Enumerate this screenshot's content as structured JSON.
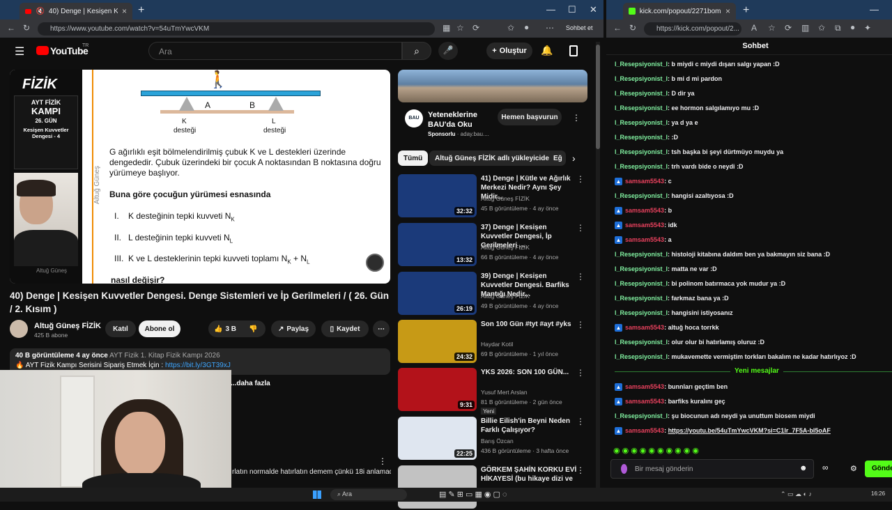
{
  "left_browser": {
    "tab_title": "40) Denge | Kesişen Kuvvetler",
    "url": "https://www.youtube.com/watch?v=54uTmYwcVKM",
    "profile_chip": "Sohbet et"
  },
  "youtube": {
    "logo": "YouTube",
    "logo_sup": "TR",
    "search_placeholder": "Ara",
    "create_label": "Oluştur",
    "video": {
      "brand": "FİZİK",
      "camp": [
        "AYT FİZİK",
        "KAMPI",
        "26. GÜN",
        "Kesişen Kuvvetler",
        "Dengesi - 4"
      ],
      "watermark": "Altuğ Güneş",
      "vert_name": "Altuğ Güneş",
      "label_a": "A",
      "label_b": "B",
      "label_k": "K",
      "label_l": "L",
      "desteği": "desteği",
      "q_text": "G ağırlıklı eşit bölmelendirilmiş çubuk K ve L destekleri üzerinde dengededir. Çubuk üzerindeki bir çocuk A noktasından B noktasına doğru yürümeye başlıyor.",
      "q_head": "Buna göre çocuğun yürümesi esnasında",
      "items": [
        {
          "n": "I.",
          "t": "K desteğinin tepki kuvveti N",
          "s": "K",
          "tail": ""
        },
        {
          "n": "II.",
          "t": "L desteğinin tepki kuvveti N",
          "s": "L",
          "tail": ""
        },
        {
          "n": "III.",
          "t": "K ve L desteklerinin tepki kuvveti toplamı N",
          "s": "K",
          "tail": " + N"
        }
      ],
      "items_tail_sub": "L",
      "q_end": "nasıl değişir?"
    },
    "title": "40) Denge | Kesişen Kuvvetler Dengesi. Denge Sistemleri ve İp Gerilmeleri / ( 26. Gün / 2. Kısım )",
    "channel": "Altuğ Güneş FİZİK",
    "subs": "425 B abone",
    "join": "Katıl",
    "subscribe": "Abone ol",
    "likes": "3 B",
    "share": "Paylaş",
    "save": "Kaydet",
    "desc_views": "40 B görüntüleme  4 ay önce",
    "desc_tags": "AYT Fizik 1. Kitap Fizik Kampı 2026",
    "desc_line": "AYT Fizik Kampı Serisini Sipariş Etmek İçin : ",
    "desc_link": "https://bit.ly/3GT39xJ",
    "more": "...daha fazla",
    "comment_snip": "rlatın normalde hatırlatın demem çünkü 18i anlamadım",
    "ad": {
      "title": "Yeteneklerine BAU'da Oku",
      "sponsor": "Sponsorlu",
      "domain": "aday.bau....",
      "button": "Hemen başvurun"
    },
    "chips": [
      "Tümü",
      "Altuğ Güneş FİZİK adlı yükleyiciden",
      "Eğ"
    ],
    "recs": [
      {
        "title": "41) Denge | Kütle ve Ağırlık Merkezi Nedir? Aynı Şey Midir...",
        "channel": "Altuğ Güneş FİZİK",
        "meta": "45 B görüntüleme · 4 ay önce",
        "dur": "32:32",
        "color": "#1b3a7a"
      },
      {
        "title": "37) Denge | Kesişen Kuvvetler Dengesi, İp Gerilmeleri ...",
        "channel": "Altuğ Güneş FİZİK",
        "meta": "66 B görüntüleme · 4 ay önce",
        "dur": "13:32",
        "color": "#1b3a7a"
      },
      {
        "title": "39) Denge | Kesişen Kuvvetler Dengesi. Barfiks Mantığı Nedir...",
        "channel": "Altuğ Güneş FİZİK",
        "meta": "49 B görüntüleme · 4 ay önce",
        "dur": "26:19",
        "color": "#1b3a7a"
      },
      {
        "title": "Son 100 Gün #tyt #ayt #yks",
        "channel": "Haydar Kotil",
        "meta": "69 B görüntüleme · 1 yıl önce",
        "dur": "24:32",
        "color": "#c79a16"
      },
      {
        "title": "YKS 2026: SON 100 GÜN...",
        "channel": "Yusuf Mert Arslan",
        "meta": "81 B görüntüleme · 2 gün önce",
        "dur": "9:31",
        "color": "#b3121a",
        "badge": "Yeni"
      },
      {
        "title": "Billie Eilish'in Beyni Neden Farklı Çalışıyor?",
        "channel": "Barış Özcan",
        "meta": "436 B görüntüleme · 3 hafta önce",
        "dur": "22:25",
        "color": "#dfe6f0"
      },
      {
        "title": "GÖRKEM ŞAHİN KORKU EVİ HİKAYESİ (bu hikaye dizi ve ...",
        "channel": "",
        "meta": "",
        "dur": "",
        "color": "#c2c2c2"
      }
    ]
  },
  "right_browser": {
    "url": "https://kick.com/popout/2...",
    "tab_title": "kick.com/popout/2271bomi/chat",
    "chat_header": "Sohbet",
    "new_msgs": "Yeni mesajlar",
    "input_placeholder": "Bir mesaj gönderin",
    "send": "Gönder"
  },
  "chat": [
    {
      "u": "l_Resepsiyonist_l",
      "m": "b miydi c miydi dışarı salgı yapan :D",
      "t": "g"
    },
    {
      "u": "l_Resepsiyonist_l",
      "m": "b mi d mi pardon",
      "t": "g"
    },
    {
      "u": "l_Resepsiyonist_l",
      "m": "D dir ya",
      "t": "g"
    },
    {
      "u": "l_Resepsiyonist_l",
      "m": "ee hormon salgılamıyo mu :D",
      "t": "g"
    },
    {
      "u": "l_Resepsiyonist_l",
      "m": "ya d ya e",
      "t": "g"
    },
    {
      "u": "l_Resepsiyonist_l",
      "m": ":D",
      "t": "g"
    },
    {
      "u": "l_Resepsiyonist_l",
      "m": "tsh başka bi şeyi dürtmüyo muydu ya",
      "t": "g"
    },
    {
      "u": "l_Resepsiyonist_l",
      "m": "trh vardı bide o neydi :D",
      "t": "g"
    },
    {
      "u": "samsam5543",
      "m": "c",
      "t": "r"
    },
    {
      "u": "l_Resepsiyonist_l",
      "m": "hangisi azaltıyosa :D",
      "t": "g"
    },
    {
      "u": "samsam5543",
      "m": "b",
      "t": "r"
    },
    {
      "u": "samsam5543",
      "m": "idk",
      "t": "r"
    },
    {
      "u": "samsam5543",
      "m": "a",
      "t": "r"
    },
    {
      "u": "l_Resepsiyonist_l",
      "m": "histoloji kitabına daldım ben ya bakmayın siz bana :D",
      "t": "g"
    },
    {
      "u": "l_Resepsiyonist_l",
      "m": "matta ne var :D",
      "t": "g"
    },
    {
      "u": "l_Resepsiyonist_l",
      "m": "bi polinom batırmaca yok mudur ya :D",
      "t": "g"
    },
    {
      "u": "l_Resepsiyonist_l",
      "m": "farkmaz bana ya :D",
      "t": "g"
    },
    {
      "u": "l_Resepsiyonist_l",
      "m": "hangisini istiyosanız",
      "t": "g"
    },
    {
      "u": "samsam5543",
      "m": "altuğ hoca torrkk",
      "t": "r"
    },
    {
      "u": "l_Resepsiyonist_l",
      "m": "olur olur bi hatırlamış oluruz :D",
      "t": "g"
    },
    {
      "u": "l_Resepsiyonist_l",
      "m": "mukavemette vermiştim torkları bakalım ne kadar hatırlıyoz :D",
      "t": "g"
    },
    {
      "u": "samsam5543",
      "m": "bunnları geçtim ben",
      "t": "r"
    },
    {
      "u": "samsam5543",
      "m": "barfiks kuralını geç",
      "t": "r"
    },
    {
      "u": "l_Resepsiyonist_l",
      "m": "şu biocunun adı neydi ya unuttum biosem miydi",
      "t": "g"
    },
    {
      "u": "samsam5543",
      "m": "https://youtu.be/54uTmYwcVKM?si=C1lr_7F5A-bI5oAF",
      "t": "r"
    }
  ],
  "taskbar": {
    "search": "Ara",
    "time": "16:26"
  }
}
